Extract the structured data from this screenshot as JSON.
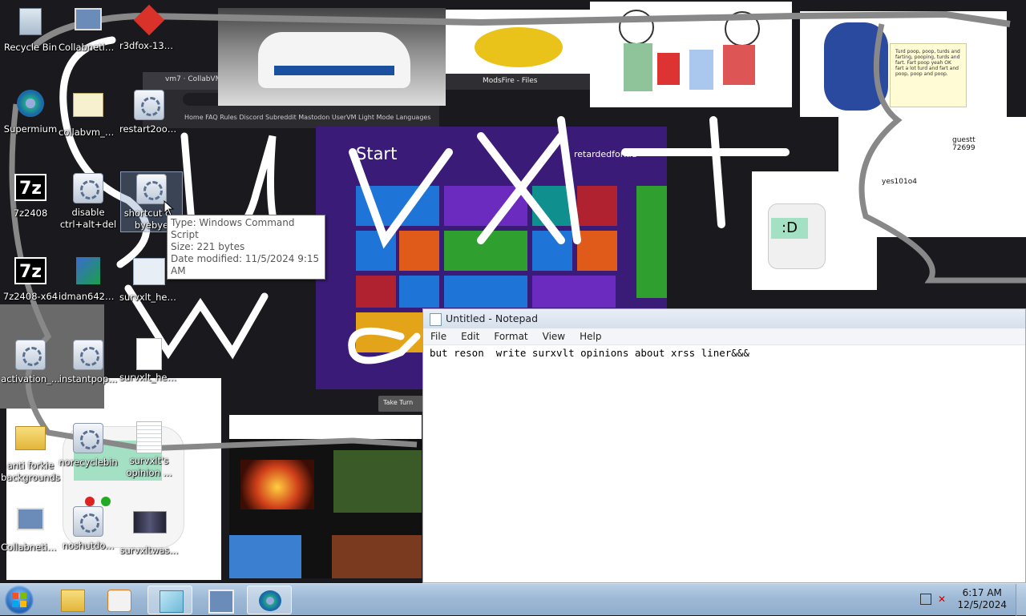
{
  "desktop": {
    "icons": [
      {
        "label": "Recycle Bin",
        "kind": "recycle-bin-icon"
      },
      {
        "label": "Collabnetin...",
        "kind": "computer-icon"
      },
      {
        "label": "r3dfox-132....",
        "kind": "fox-icon"
      },
      {
        "label": "Supermium",
        "kind": "browser-icon"
      },
      {
        "label": "collabvm_c...",
        "kind": "certificate-icon"
      },
      {
        "label": "restart2oobe",
        "kind": "script-icon"
      },
      {
        "label": "7z2408",
        "kind": "7zip-icon"
      },
      {
        "label": "disable ctrl+alt+del",
        "kind": "script-icon"
      },
      {
        "label": "shortcut c... byebye",
        "kind": "script-icon"
      },
      {
        "label": "7z2408-x64",
        "kind": "7zip-icon"
      },
      {
        "label": "idman642b...",
        "kind": "installer-icon"
      },
      {
        "label": "survxlt_her...",
        "kind": "batch-icon"
      },
      {
        "label": "activation_...",
        "kind": "script-icon"
      },
      {
        "label": "instantpop...",
        "kind": "script-icon"
      },
      {
        "label": "survxlt_here...",
        "kind": "document-icon"
      },
      {
        "label": "anti forkie backgrounds",
        "kind": "folder-icon"
      },
      {
        "label": "norecyclebin",
        "kind": "script-icon"
      },
      {
        "label": "survxlt's opinion ...",
        "kind": "text-file-icon"
      },
      {
        "label": "Collabnetin...",
        "kind": "computer-icon"
      },
      {
        "label": "noshutdo...",
        "kind": "script-icon"
      },
      {
        "label": "survxltwas...",
        "kind": "image-icon"
      }
    ],
    "tooltip": {
      "type": "Type: Windows Command Script",
      "size": "Size: 221 bytes",
      "modified": "Date modified: 11/5/2024 9:15 AM"
    },
    "wallpaper_text": {
      "browser_tab": "vm7 · CollabVM",
      "browser_tab2": "ModsFire - Files",
      "nav": "Home  FAQ  Rules  Discord  Subreddit  Mastodon  UserVM  Light Mode  Languages",
      "start_screen_title": "Start",
      "start_user": "retardedforkie",
      "scribble": "Survxlt wa",
      "take_turn": "Take Turn",
      "comic_text": "Turd poop, poop, turds and farting, pooping, turds and fart. Fart poop yeah OK fart a lot turd and fart and poop, poop and poop.",
      "chat1": "guestt 72699",
      "chat2": "yes101o4",
      "sticker": ":D"
    }
  },
  "notepad": {
    "title": "Untitled - Notepad",
    "menu": [
      "File",
      "Edit",
      "Format",
      "View",
      "Help"
    ],
    "content": "but reson  write surxvlt opinions about xrss liner&&&"
  },
  "taskbar": {
    "time": "6:17 AM",
    "date": "12/5/2024",
    "colors": {
      "taskbar": "#a7c0dc",
      "start": "#1d5fb0"
    }
  }
}
